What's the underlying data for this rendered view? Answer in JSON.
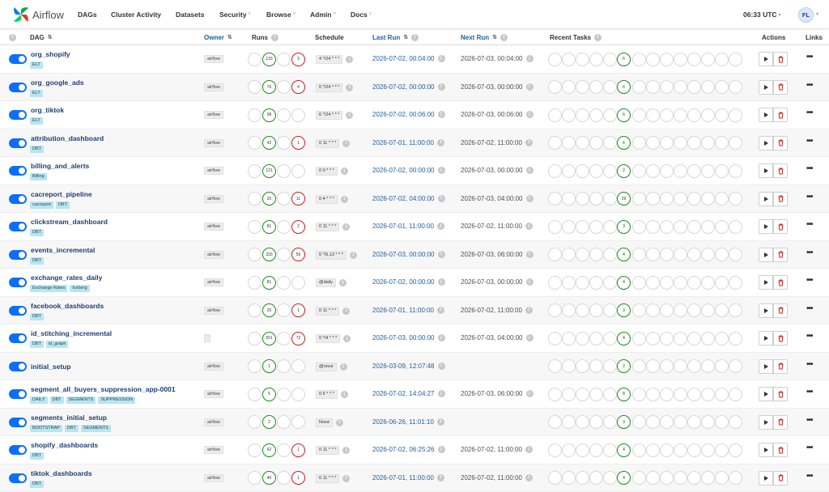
{
  "nav": {
    "brand": "Airflow",
    "items": [
      {
        "label": "DAGs",
        "dropdown": false
      },
      {
        "label": "Cluster Activity",
        "dropdown": false
      },
      {
        "label": "Datasets",
        "dropdown": false
      },
      {
        "label": "Security",
        "dropdown": true
      },
      {
        "label": "Browse",
        "dropdown": true
      },
      {
        "label": "Admin",
        "dropdown": true
      },
      {
        "label": "Docs",
        "dropdown": true
      }
    ],
    "time": "06:33 UTC",
    "user_initials": "FL"
  },
  "table": {
    "columns": {
      "dag": "DAG",
      "owner": "Owner",
      "runs": "Runs",
      "schedule": "Schedule",
      "last_run": "Last Run",
      "next_run": "Next Run",
      "recent_tasks": "Recent Tasks",
      "actions": "Actions",
      "links": "Links"
    },
    "rows": [
      {
        "dag_id": "org_shopify",
        "tags": [
          "ELT"
        ],
        "owner": "airflow",
        "runs_success": "133",
        "runs_failed": "3",
        "schedule": "4 */24 * * *",
        "last_run": "2026-07-02, 00:04:00",
        "next_run": "2026-07-03, 00:04:00",
        "tasks_success": "6"
      },
      {
        "dag_id": "org_google_ads",
        "tags": [
          "ELT"
        ],
        "owner": "airflow",
        "runs_success": "76",
        "runs_failed": "4",
        "schedule": "0 */24 * * *",
        "last_run": "2026-07-02, 00:00:00",
        "next_run": "2026-07-03, 00:00:00",
        "tasks_success": "6"
      },
      {
        "dag_id": "org_tiktok",
        "tags": [
          "ELT"
        ],
        "owner": "airflow",
        "runs_success": "98",
        "runs_failed": "",
        "schedule": "6 */24 * * *",
        "last_run": "2026-07-02, 00:06:00",
        "next_run": "2026-07-03, 00:06:00",
        "tasks_success": "6"
      },
      {
        "dag_id": "attribution_dashboard",
        "tags": [
          "DBT"
        ],
        "owner": "airflow",
        "runs_success": "42",
        "runs_failed": "1",
        "schedule": "0 11 * * *",
        "last_run": "2026-07-01, 11:00:00",
        "next_run": "2026-07-02, 11:00:00",
        "tasks_success": "6"
      },
      {
        "dag_id": "billing_and_alerts",
        "tags": [
          "Billing"
        ],
        "owner": "airflow",
        "runs_success": "121",
        "runs_failed": "",
        "schedule": "0 0 * * *",
        "last_run": "2026-07-02, 00:00:00",
        "next_run": "2026-07-03, 00:00:00",
        "tasks_success": "2"
      },
      {
        "dag_id": "cacreport_pipeline",
        "tags": [
          "cacreport",
          "DBT"
        ],
        "owner": "airflow",
        "runs_success": "20",
        "runs_failed": "11",
        "schedule": "0 4 * * *",
        "last_run": "2026-07-02, 04:00:00",
        "next_run": "2026-07-03, 04:00:00",
        "tasks_success": "29"
      },
      {
        "dag_id": "clickstream_dashboard",
        "tags": [
          "DBT"
        ],
        "owner": "airflow",
        "runs_success": "81",
        "runs_failed": "2",
        "schedule": "0 11 * * *",
        "last_run": "2026-07-01, 11:00:00",
        "next_run": "2026-07-02, 11:00:00",
        "tasks_success": "3"
      },
      {
        "dag_id": "events_incremental",
        "tags": [
          "DBT"
        ],
        "owner": "airflow",
        "runs_success": "333",
        "runs_failed": "56",
        "schedule": "0 */6,13 * * *",
        "last_run": "2026-07-03, 00:00:00",
        "next_run": "2026-07-03, 06:00:00",
        "tasks_success": "4"
      },
      {
        "dag_id": "exchange_rates_daily",
        "tags": [
          "Exchange Rates",
          "Iceberg"
        ],
        "owner": "airflow",
        "runs_success": "81",
        "runs_failed": "",
        "schedule": "@daily",
        "last_run": "2026-07-02, 00:00:00",
        "next_run": "2026-07-03, 00:00:00",
        "tasks_success": "4"
      },
      {
        "dag_id": "facebook_dashboards",
        "tags": [
          "DBT"
        ],
        "owner": "airflow",
        "runs_success": "20",
        "runs_failed": "1",
        "schedule": "0 11 * * *",
        "last_run": "2026-07-01, 11:00:00",
        "next_run": "2026-07-02, 11:00:00",
        "tasks_success": "3"
      },
      {
        "dag_id": "id_stitching_incremental",
        "tags": [
          "DBT",
          "id_graph"
        ],
        "owner": "",
        "runs_success": "551",
        "runs_failed": "72",
        "schedule": "0 */4 * * *",
        "last_run": "2026-07-03, 00:00:00",
        "next_run": "2026-07-03, 04:00:00",
        "tasks_success": "4"
      },
      {
        "dag_id": "initial_setup",
        "tags": [],
        "owner": "airflow",
        "runs_success": "1",
        "runs_failed": "",
        "schedule": "@once",
        "last_run": "2026-03-09, 12:07:48",
        "next_run": "",
        "tasks_success": "2"
      },
      {
        "dag_id": "segment_all_buyers_suppression_app-0001",
        "tags": [
          "DAILY",
          "DBT",
          "SEGMENTS",
          "SUPPRESSION"
        ],
        "owner": "airflow",
        "runs_success": "5",
        "runs_failed": "",
        "schedule": "0 6 * * *",
        "last_run": "2026-07-02, 14:04:27",
        "next_run": "2026-07-03, 06:00:00",
        "tasks_success": "8"
      },
      {
        "dag_id": "segments_initial_setup",
        "tags": [
          "BOOTSTRAP",
          "DBT",
          "SEGMENTS"
        ],
        "owner": "airflow",
        "runs_success": "2",
        "runs_failed": "",
        "schedule": "None",
        "last_run": "2026-06-26, 11:01:10",
        "next_run": "",
        "tasks_success": "3"
      },
      {
        "dag_id": "shopify_dashboards",
        "tags": [
          "DBT"
        ],
        "owner": "airflow",
        "runs_success": "62",
        "runs_failed": "1",
        "schedule": "0 11 * * *",
        "last_run": "2026-07-02, 06:25:26",
        "next_run": "2026-07-02, 11:00:00",
        "tasks_success": "4"
      },
      {
        "dag_id": "tiktok_dashboards",
        "tags": [
          "DBT"
        ],
        "owner": "airflow",
        "runs_success": "40",
        "runs_failed": "1",
        "schedule": "0 11 * * *",
        "last_run": "2026-07-01, 11:00:00",
        "next_run": "2026-07-02, 11:00:00",
        "tasks_success": "4"
      }
    ]
  },
  "colors": {
    "success": "#1d8a1d",
    "failed": "#d21c1c",
    "toggle_on": "#0d6efd",
    "tag_bg": "#b9e5f0",
    "link": "#1f5d9c"
  }
}
